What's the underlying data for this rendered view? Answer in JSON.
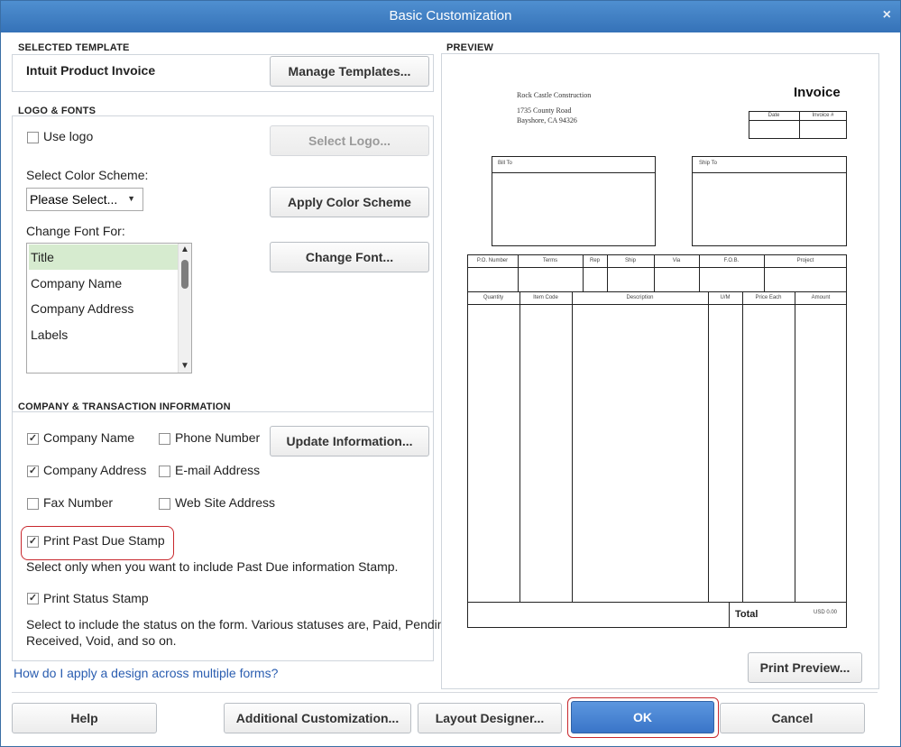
{
  "window": {
    "title": "Basic Customization",
    "close_glyph": "×"
  },
  "selected_template": {
    "section_label": "SELECTED TEMPLATE",
    "name": "Intuit Product Invoice",
    "manage_button": "Manage Templates..."
  },
  "logo_fonts": {
    "section_label": "LOGO & FONTS",
    "use_logo": {
      "label": "Use logo",
      "checked": false
    },
    "select_logo_button": "Select Logo...",
    "color_scheme_label": "Select Color Scheme:",
    "color_scheme_value": "Please Select...",
    "apply_color_button": "Apply Color Scheme",
    "change_font_label": "Change Font For:",
    "font_items": [
      "Title",
      "Company Name",
      "Company Address",
      "Labels"
    ],
    "selected_font_item": "Title",
    "change_font_button": "Change Font..."
  },
  "company_info": {
    "section_label": "COMPANY & TRANSACTION INFORMATION",
    "company_name": {
      "label": "Company Name",
      "checked": true
    },
    "phone_number": {
      "label": "Phone Number",
      "checked": false
    },
    "company_address": {
      "label": "Company Address",
      "checked": true
    },
    "email_address": {
      "label": "E-mail Address",
      "checked": false
    },
    "fax_number": {
      "label": "Fax Number",
      "checked": false
    },
    "web_site": {
      "label": "Web Site Address",
      "checked": false
    },
    "update_button": "Update Information...",
    "past_due": {
      "label": "Print Past Due Stamp",
      "checked": true
    },
    "past_due_help": "Select only when you want to include Past Due information Stamp.",
    "status_stamp": {
      "label": "Print Status Stamp",
      "checked": true
    },
    "status_help_line1": "Select to include the status on the form. Various statuses are, Paid, Pending,",
    "status_help_line2": "Received, Void, and so on."
  },
  "help_link": "How do I apply a design across multiple forms?",
  "preview": {
    "section_label": "PREVIEW",
    "company_name": "Rock Castle Construction",
    "address_line1": "1735 County Road",
    "address_line2": "Bayshore, CA 94326",
    "title": "Invoice",
    "date_header": "Date",
    "invoice_no_header": "Invoice #",
    "bill_to": "Bill To",
    "ship_to": "Ship To",
    "info_headers": [
      "P.O. Number",
      "Terms",
      "Rep",
      "Ship",
      "Via",
      "F.O.B.",
      "Project"
    ],
    "line_headers": [
      "Quantity",
      "Item Code",
      "Description",
      "U/M",
      "Price Each",
      "Amount"
    ],
    "total_label": "Total",
    "total_value": "USD 0.00",
    "print_preview_button": "Print Preview..."
  },
  "footer": {
    "help": "Help",
    "additional": "Additional Customization...",
    "layout_designer": "Layout Designer...",
    "ok": "OK",
    "cancel": "Cancel"
  },
  "colors": {
    "titlebar": "#3a7bc8",
    "ok_button": "#3f7fd2",
    "highlight": "#c8282d",
    "link": "#2a5db0",
    "selected_row": "#d6ebcf"
  }
}
